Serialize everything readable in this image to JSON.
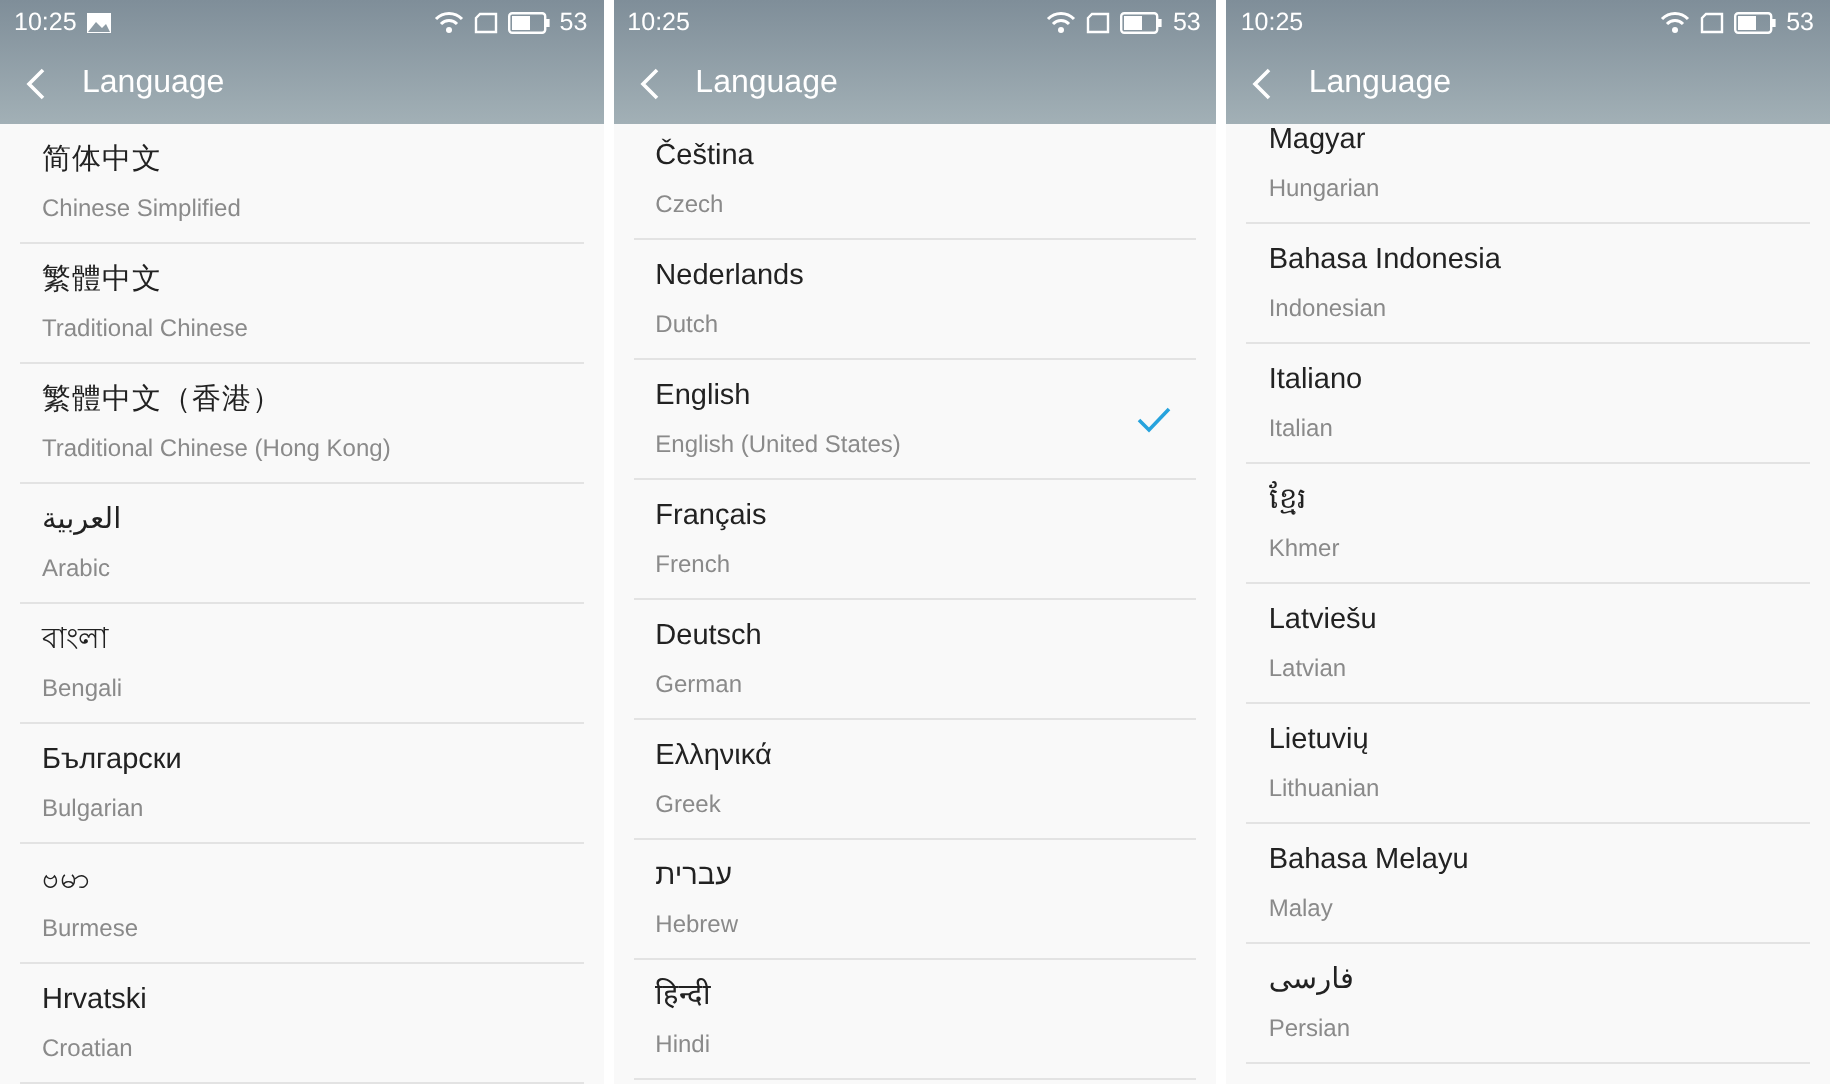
{
  "screens": [
    {
      "status_bar": {
        "time": "10:25",
        "image_notification": true,
        "battery": "53"
      },
      "title": "Language",
      "languages": [
        {
          "name": "简体中文",
          "english": "Chinese Simplified",
          "selected": false
        },
        {
          "name": "繁體中文",
          "english": "Traditional Chinese",
          "selected": false
        },
        {
          "name": "繁體中文（香港）",
          "english": "Traditional Chinese (Hong Kong)",
          "selected": false
        },
        {
          "name": "العربية",
          "english": "Arabic",
          "selected": false
        },
        {
          "name": "বাংলা",
          "english": "Bengali",
          "selected": false
        },
        {
          "name": "Български",
          "english": "Bulgarian",
          "selected": false
        },
        {
          "name": "ဗမာ",
          "english": "Burmese",
          "selected": false
        },
        {
          "name": "Hrvatski",
          "english": "Croatian",
          "selected": false
        }
      ]
    },
    {
      "status_bar": {
        "time": "10:25",
        "image_notification": false,
        "battery": "53"
      },
      "title": "Language",
      "languages": [
        {
          "name": "Čeština",
          "english": "Czech",
          "selected": false
        },
        {
          "name": "Nederlands",
          "english": "Dutch",
          "selected": false
        },
        {
          "name": "English",
          "english": "English (United States)",
          "selected": true
        },
        {
          "name": "Français",
          "english": "French",
          "selected": false
        },
        {
          "name": "Deutsch",
          "english": "German",
          "selected": false
        },
        {
          "name": "Ελληνικά",
          "english": "Greek",
          "selected": false
        },
        {
          "name": "עברית",
          "english": "Hebrew",
          "selected": false
        },
        {
          "name": "हिन्दी",
          "english": "Hindi",
          "selected": false
        }
      ]
    },
    {
      "status_bar": {
        "time": "10:25",
        "image_notification": false,
        "battery": "53"
      },
      "title": "Language",
      "languages": [
        {
          "name": "Magyar",
          "english": "Hungarian",
          "selected": false
        },
        {
          "name": "Bahasa Indonesia",
          "english": "Indonesian",
          "selected": false
        },
        {
          "name": "Italiano",
          "english": "Italian",
          "selected": false
        },
        {
          "name": "ខ្មែរ",
          "english": "Khmer",
          "selected": false
        },
        {
          "name": "Latviešu",
          "english": "Latvian",
          "selected": false
        },
        {
          "name": "Lietuvių",
          "english": "Lithuanian",
          "selected": false
        },
        {
          "name": "Bahasa Melayu",
          "english": "Malay",
          "selected": false
        },
        {
          "name": "فارسی",
          "english": "Persian",
          "selected": false
        }
      ]
    }
  ]
}
